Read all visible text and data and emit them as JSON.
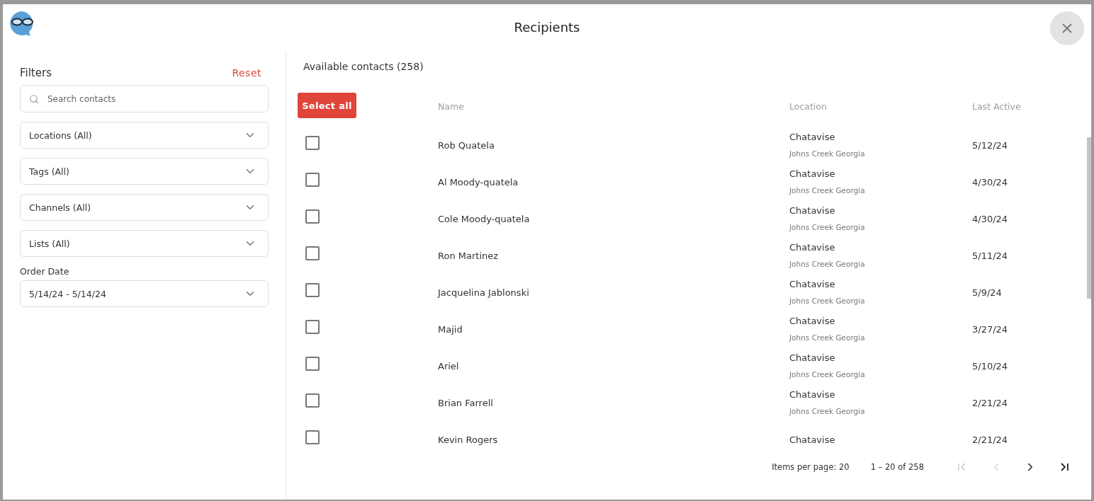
{
  "dialog": {
    "title": "Recipients"
  },
  "filters": {
    "title": "Filters",
    "reset": "Reset",
    "search": {
      "placeholder": "Search contacts"
    },
    "dropdowns": [
      {
        "label": "Locations (All)"
      },
      {
        "label": "Tags (All)"
      },
      {
        "label": "Channels (All)"
      },
      {
        "label": "Lists (All)"
      }
    ],
    "order_date": {
      "label": "Order Date",
      "value": "5/14/24 - 5/14/24"
    }
  },
  "contacts": {
    "title": "Available contacts (258)",
    "select_all": "Select all",
    "columns": [
      "Name",
      "Location",
      "Last Active"
    ],
    "rows": [
      {
        "checked": false,
        "name": "Rob Quatela",
        "location": "Chatavise",
        "address": "Johns Creek Georgia",
        "last_active": "5/12/24"
      },
      {
        "checked": false,
        "name": "Al Moody-quatela",
        "location": "Chatavise",
        "address": "Johns Creek Georgia",
        "last_active": "4/30/24"
      },
      {
        "checked": false,
        "name": "Cole Moody-quatela",
        "location": "Chatavise",
        "address": "Johns Creek Georgia",
        "last_active": "4/30/24"
      },
      {
        "checked": false,
        "name": "Ron Martinez",
        "location": "Chatavise",
        "address": "Johns Creek Georgia",
        "last_active": "5/11/24"
      },
      {
        "checked": false,
        "name": "Jacquelina Jablonski",
        "location": "Chatavise",
        "address": "Johns Creek Georgia",
        "last_active": "5/9/24"
      },
      {
        "checked": false,
        "name": "Majid",
        "location": "Chatavise",
        "address": "Johns Creek Georgia",
        "last_active": "3/27/24"
      },
      {
        "checked": false,
        "name": "Ariel",
        "location": "Chatavise",
        "address": "Johns Creek Georgia",
        "last_active": "5/10/24"
      },
      {
        "checked": false,
        "name": "Brian Farrell",
        "location": "Chatavise",
        "address": "Johns Creek Georgia",
        "last_active": "2/21/24"
      },
      {
        "checked": false,
        "name": "Kevin Rogers",
        "location": "Chatavise",
        "last_active": "2/21/24"
      }
    ],
    "paginator": {
      "items_per_page": "Items per page: 20",
      "range": "1 – 20 of 258",
      "buttons": [
        {
          "kind": "first",
          "disabled": true
        },
        {
          "kind": "prev",
          "disabled": true
        },
        {
          "kind": "next",
          "disabled": false
        },
        {
          "kind": "last",
          "disabled": false
        }
      ]
    }
  }
}
